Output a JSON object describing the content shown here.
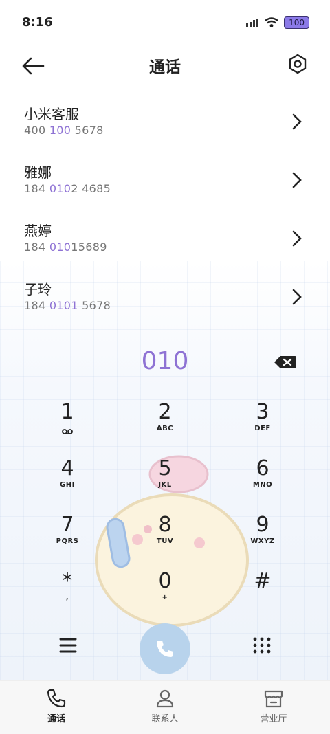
{
  "status_bar": {
    "time": "8:16",
    "battery": "100"
  },
  "header": {
    "title": "通话"
  },
  "results": [
    {
      "name": "小米客服",
      "number_parts": [
        "400 ",
        "100",
        " 5678"
      ]
    },
    {
      "name": "雅娜",
      "number_parts": [
        "184 ",
        "010",
        "2 4685"
      ]
    },
    {
      "name": "燕婷",
      "number_parts": [
        "184 ",
        "010",
        "15689"
      ]
    },
    {
      "name": "子玲",
      "number_parts": [
        "184 ",
        "0101",
        " 5678"
      ]
    }
  ],
  "dialed": "010",
  "keypad": [
    {
      "digit": "1",
      "letters": ""
    },
    {
      "digit": "2",
      "letters": "ABC"
    },
    {
      "digit": "3",
      "letters": "DEF"
    },
    {
      "digit": "4",
      "letters": "GHI"
    },
    {
      "digit": "5",
      "letters": "JKL"
    },
    {
      "digit": "6",
      "letters": "MNO"
    },
    {
      "digit": "7",
      "letters": "PQRS"
    },
    {
      "digit": "8",
      "letters": "TUV"
    },
    {
      "digit": "9",
      "letters": "WXYZ"
    },
    {
      "digit": "*",
      "letters": ","
    },
    {
      "digit": "0",
      "letters": "+"
    },
    {
      "digit": "#",
      "letters": ""
    }
  ],
  "bottom_nav": [
    {
      "label": "通话",
      "icon": "phone-icon",
      "active": true
    },
    {
      "label": "联系人",
      "icon": "person-icon",
      "active": false
    },
    {
      "label": "营业厅",
      "icon": "store-icon",
      "active": false
    }
  ],
  "colors": {
    "accent": "#8e72d4",
    "call_button": "#b8d3ec"
  }
}
